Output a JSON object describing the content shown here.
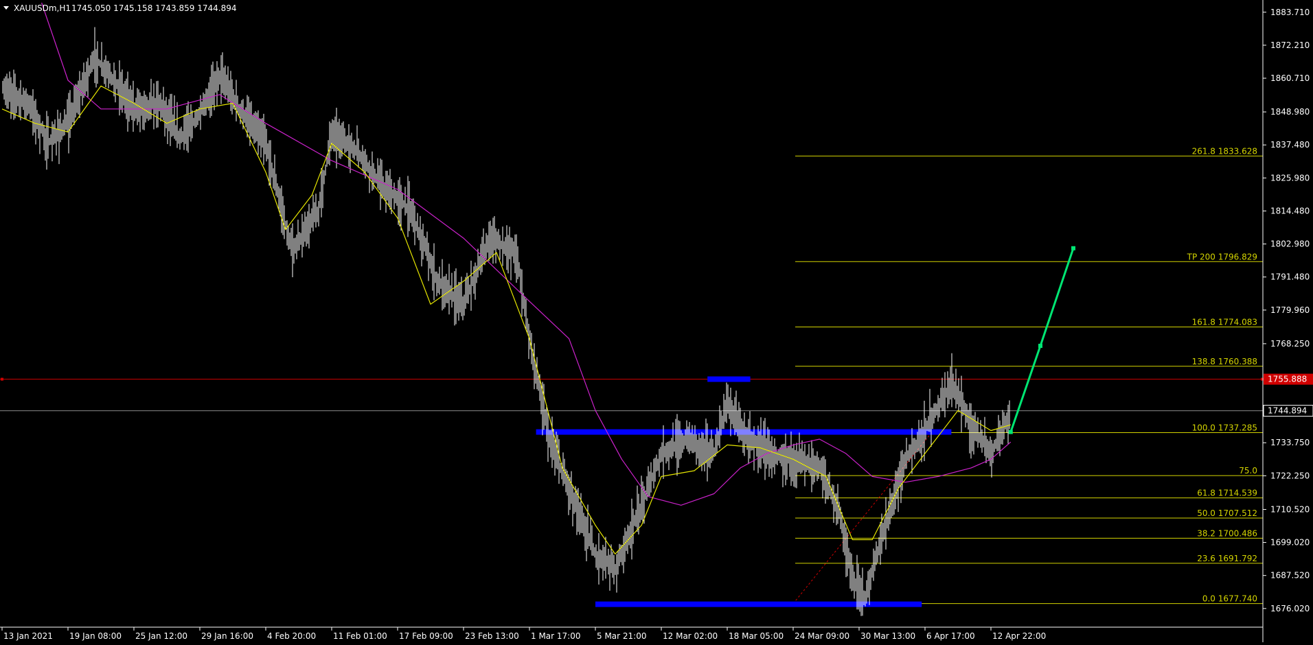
{
  "header": {
    "symbol": "XAUUSDm,H1",
    "ohlc": "1745.050 1745.158 1743.859 1744.894"
  },
  "colors": {
    "background": "#000000",
    "candles": "#ffffff",
    "ma_fast": "#e6e600",
    "ma_slow": "#cc22cc",
    "fib": "#d4d400",
    "zones": "#0000ff",
    "price_line": "#d00000",
    "bid_line": "#8a8a8a",
    "projection": "#00e673",
    "axis_text": "#ffffff"
  },
  "chart_data": {
    "type": "line",
    "title": "",
    "ylim": [
      1670,
      1887
    ],
    "y_ticks": [
      "1883.710",
      "1872.210",
      "1860.710",
      "1848.980",
      "1837.480",
      "1825.980",
      "1814.480",
      "1802.980",
      "1791.480",
      "1779.960",
      "1768.250",
      "1733.750",
      "1722.250",
      "1710.520",
      "1699.020",
      "1687.520",
      "1676.020"
    ],
    "x_ticks": [
      {
        "index": 0,
        "label": "13 Jan 2021"
      },
      {
        "index": 1,
        "label": "19 Jan 08:00"
      },
      {
        "index": 2,
        "label": "25 Jan 12:00"
      },
      {
        "index": 3,
        "label": "29 Jan 16:00"
      },
      {
        "index": 4,
        "label": "4 Feb 20:00"
      },
      {
        "index": 5,
        "label": "11 Feb 01:00"
      },
      {
        "index": 6,
        "label": "17 Feb 09:00"
      },
      {
        "index": 7,
        "label": "23 Feb 13:00"
      },
      {
        "index": 8,
        "label": "1 Mar 17:00"
      },
      {
        "index": 9,
        "label": "5 Mar 21:00"
      },
      {
        "index": 10,
        "label": "12 Mar 02:00"
      },
      {
        "index": 11,
        "label": "18 Mar 05:00"
      },
      {
        "index": 12,
        "label": "24 Mar 09:00"
      },
      {
        "index": 13,
        "label": "30 Mar 13:00"
      },
      {
        "index": 14,
        "label": "6 Apr 17:00"
      },
      {
        "index": 15,
        "label": "12 Apr 22:00"
      }
    ],
    "price_path": [
      [
        0.0,
        1857
      ],
      [
        0.4,
        1852
      ],
      [
        0.7,
        1838
      ],
      [
        1.0,
        1845
      ],
      [
        1.4,
        1868
      ],
      [
        1.7,
        1860
      ],
      [
        2.0,
        1850
      ],
      [
        2.4,
        1852
      ],
      [
        2.7,
        1840
      ],
      [
        3.0,
        1848
      ],
      [
        3.3,
        1862
      ],
      [
        3.6,
        1850
      ],
      [
        4.0,
        1838
      ],
      [
        4.4,
        1800
      ],
      [
        4.8,
        1815
      ],
      [
        5.0,
        1842
      ],
      [
        5.4,
        1835
      ],
      [
        5.8,
        1822
      ],
      [
        6.2,
        1815
      ],
      [
        6.6,
        1790
      ],
      [
        7.0,
        1782
      ],
      [
        7.4,
        1805
      ],
      [
        7.8,
        1800
      ],
      [
        8.0,
        1770
      ],
      [
        8.3,
        1735
      ],
      [
        8.6,
        1718
      ],
      [
        9.0,
        1695
      ],
      [
        9.3,
        1690
      ],
      [
        9.7,
        1712
      ],
      [
        10.0,
        1730
      ],
      [
        10.4,
        1735
      ],
      [
        10.8,
        1730
      ],
      [
        11.0,
        1748
      ],
      [
        11.3,
        1735
      ],
      [
        11.7,
        1730
      ],
      [
        12.0,
        1728
      ],
      [
        12.4,
        1725
      ],
      [
        12.7,
        1710
      ],
      [
        12.9,
        1685
      ],
      [
        13.1,
        1680
      ],
      [
        13.4,
        1705
      ],
      [
        13.7,
        1728
      ],
      [
        14.0,
        1738
      ],
      [
        14.4,
        1755
      ],
      [
        14.7,
        1740
      ],
      [
        15.0,
        1730
      ],
      [
        15.3,
        1745
      ]
    ],
    "ma_fast": [
      [
        0.0,
        1850
      ],
      [
        0.5,
        1845
      ],
      [
        1.0,
        1842
      ],
      [
        1.5,
        1858
      ],
      [
        2.0,
        1852
      ],
      [
        2.5,
        1845
      ],
      [
        3.0,
        1850
      ],
      [
        3.5,
        1852
      ],
      [
        4.0,
        1828
      ],
      [
        4.3,
        1808
      ],
      [
        4.7,
        1820
      ],
      [
        5.0,
        1838
      ],
      [
        5.5,
        1828
      ],
      [
        6.0,
        1812
      ],
      [
        6.5,
        1782
      ],
      [
        7.0,
        1790
      ],
      [
        7.5,
        1800
      ],
      [
        8.0,
        1770
      ],
      [
        8.5,
        1725
      ],
      [
        9.0,
        1705
      ],
      [
        9.3,
        1695
      ],
      [
        9.7,
        1705
      ],
      [
        10.0,
        1722
      ],
      [
        10.5,
        1724
      ],
      [
        11.0,
        1733
      ],
      [
        11.5,
        1732
      ],
      [
        12.0,
        1728
      ],
      [
        12.5,
        1722
      ],
      [
        12.9,
        1700
      ],
      [
        13.2,
        1700
      ],
      [
        13.6,
        1718
      ],
      [
        14.0,
        1730
      ],
      [
        14.5,
        1745
      ],
      [
        15.0,
        1738
      ],
      [
        15.3,
        1740
      ]
    ],
    "ma_slow": [
      [
        0.6,
        1887
      ],
      [
        1.0,
        1860
      ],
      [
        1.5,
        1850
      ],
      [
        2.5,
        1850
      ],
      [
        3.3,
        1855
      ],
      [
        4.0,
        1845
      ],
      [
        5.0,
        1832
      ],
      [
        6.0,
        1822
      ],
      [
        7.0,
        1805
      ],
      [
        8.0,
        1783
      ],
      [
        8.6,
        1770
      ],
      [
        9.0,
        1745
      ],
      [
        9.4,
        1728
      ],
      [
        9.8,
        1715
      ],
      [
        10.3,
        1712
      ],
      [
        10.8,
        1716
      ],
      [
        11.2,
        1725
      ],
      [
        11.6,
        1730
      ],
      [
        12.0,
        1733
      ],
      [
        12.4,
        1735
      ],
      [
        12.8,
        1730
      ],
      [
        13.2,
        1722
      ],
      [
        13.7,
        1720
      ],
      [
        14.2,
        1722
      ],
      [
        14.7,
        1725
      ],
      [
        15.0,
        1728
      ],
      [
        15.3,
        1734
      ]
    ],
    "fib_levels": [
      {
        "price": 1833.628,
        "label": "261.8 1833.628"
      },
      {
        "price": 1796.829,
        "label": "TP 200 1796.829"
      },
      {
        "price": 1774.083,
        "label": "161.8 1774.083"
      },
      {
        "price": 1760.388,
        "label": "138.8 1760.388"
      },
      {
        "price": 1737.285,
        "label": "100.0 1737.285"
      },
      {
        "price": 1722.3,
        "label": "75.0"
      },
      {
        "price": 1714.539,
        "label": "61.8 1714.539"
      },
      {
        "price": 1707.512,
        "label": "50.0 1707.512"
      },
      {
        "price": 1700.486,
        "label": "38.2 1700.486"
      },
      {
        "price": 1691.792,
        "label": "23.6 1691.792"
      },
      {
        "price": 1677.74,
        "label": "0.0 1677.740"
      }
    ],
    "zones": [
      {
        "x0": 10.7,
        "x1": 11.35,
        "price": 1755.9
      },
      {
        "x0": 8.1,
        "x1": 14.4,
        "price": 1737.5
      },
      {
        "x0": 9.0,
        "x1": 13.95,
        "price": 1677.5
      }
    ],
    "projection": [
      [
        15.3,
        1737.5
      ],
      [
        15.75,
        1767.5
      ],
      [
        16.25,
        1801.5
      ]
    ],
    "fib_trend": [
      [
        12.0,
        1677.7
      ],
      [
        14.1,
        1737.3
      ]
    ],
    "current_price": {
      "value": 1744.894,
      "label": "1744.894"
    },
    "alert_line": {
      "value": 1755.888,
      "label": "1755.888"
    }
  }
}
